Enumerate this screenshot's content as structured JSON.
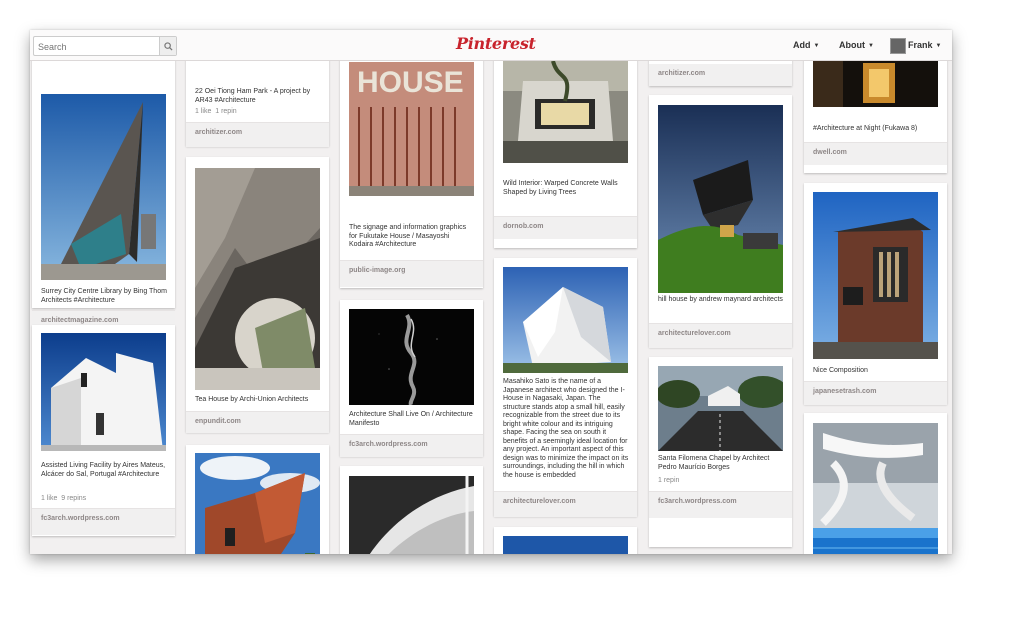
{
  "header": {
    "search_placeholder": "Search",
    "logo": "Pinterest",
    "nav": {
      "add": "Add",
      "about": "About",
      "user": "Frank"
    }
  },
  "pins": {
    "surrey": {
      "desc": "Surrey City Centre Library by Bing Thom Architects #Architecture",
      "source": "architectmagazine.com"
    },
    "assisted": {
      "desc": "Assisted Living Facility by Aires Mateus, Alcácer do Sal, Portugal #Architecture",
      "likes": "1 like",
      "repins": "9 repins",
      "source": "fc3arch.wordpress.com"
    },
    "oei": {
      "desc": "22 Oei Tiong Ham Park - A project by AR43 #Architecture",
      "likes": "1 like",
      "repins": "1 repin",
      "source": "architizer.com"
    },
    "teahouse": {
      "desc": "Tea House by Archi-Union Architects",
      "source": "enpundit.com"
    },
    "signage": {
      "desc": "The signage and information graphics for Fukutake House / Masayoshi Kodaira #Architecture",
      "source": "public-image.org"
    },
    "manifesto": {
      "desc": "Architecture Shall Live On / Architecture Manifesto",
      "source": "fc3arch.wordpress.com"
    },
    "wild": {
      "desc": "Wild Interior: Warped Concrete Walls Shaped by Living Trees",
      "source": "dornob.com"
    },
    "masahiko": {
      "desc": "Masahiko Sato is the name of a Japanese architect who designed the I-House in Nagasaki, Japan. The structure stands atop a small hill, easily recognizable from the street due to its bright white colour and its intriguing shape. Facing the sea on south it benefits of a seemingly ideal location for any project. An important aspect of this design was to minimize the impact on its surroundings, including the hill in which the house is embedded",
      "source": "architecturelover.com"
    },
    "top4": {
      "source": "architizer.com"
    },
    "hillhouse": {
      "desc": "hill house by andrew maynard architects",
      "source": "architecturelover.com"
    },
    "chapel": {
      "desc": "Santa Filomena Chapel by Architect Pedro Maurício Borges",
      "repins": "1 repin",
      "source": "fc3arch.wordpress.com"
    },
    "night": {
      "desc": "#Architecture at Night (Fukawa 8)",
      "source": "dwell.com"
    },
    "nice": {
      "desc": "Nice Composition",
      "source": "japanesetrash.com"
    }
  }
}
